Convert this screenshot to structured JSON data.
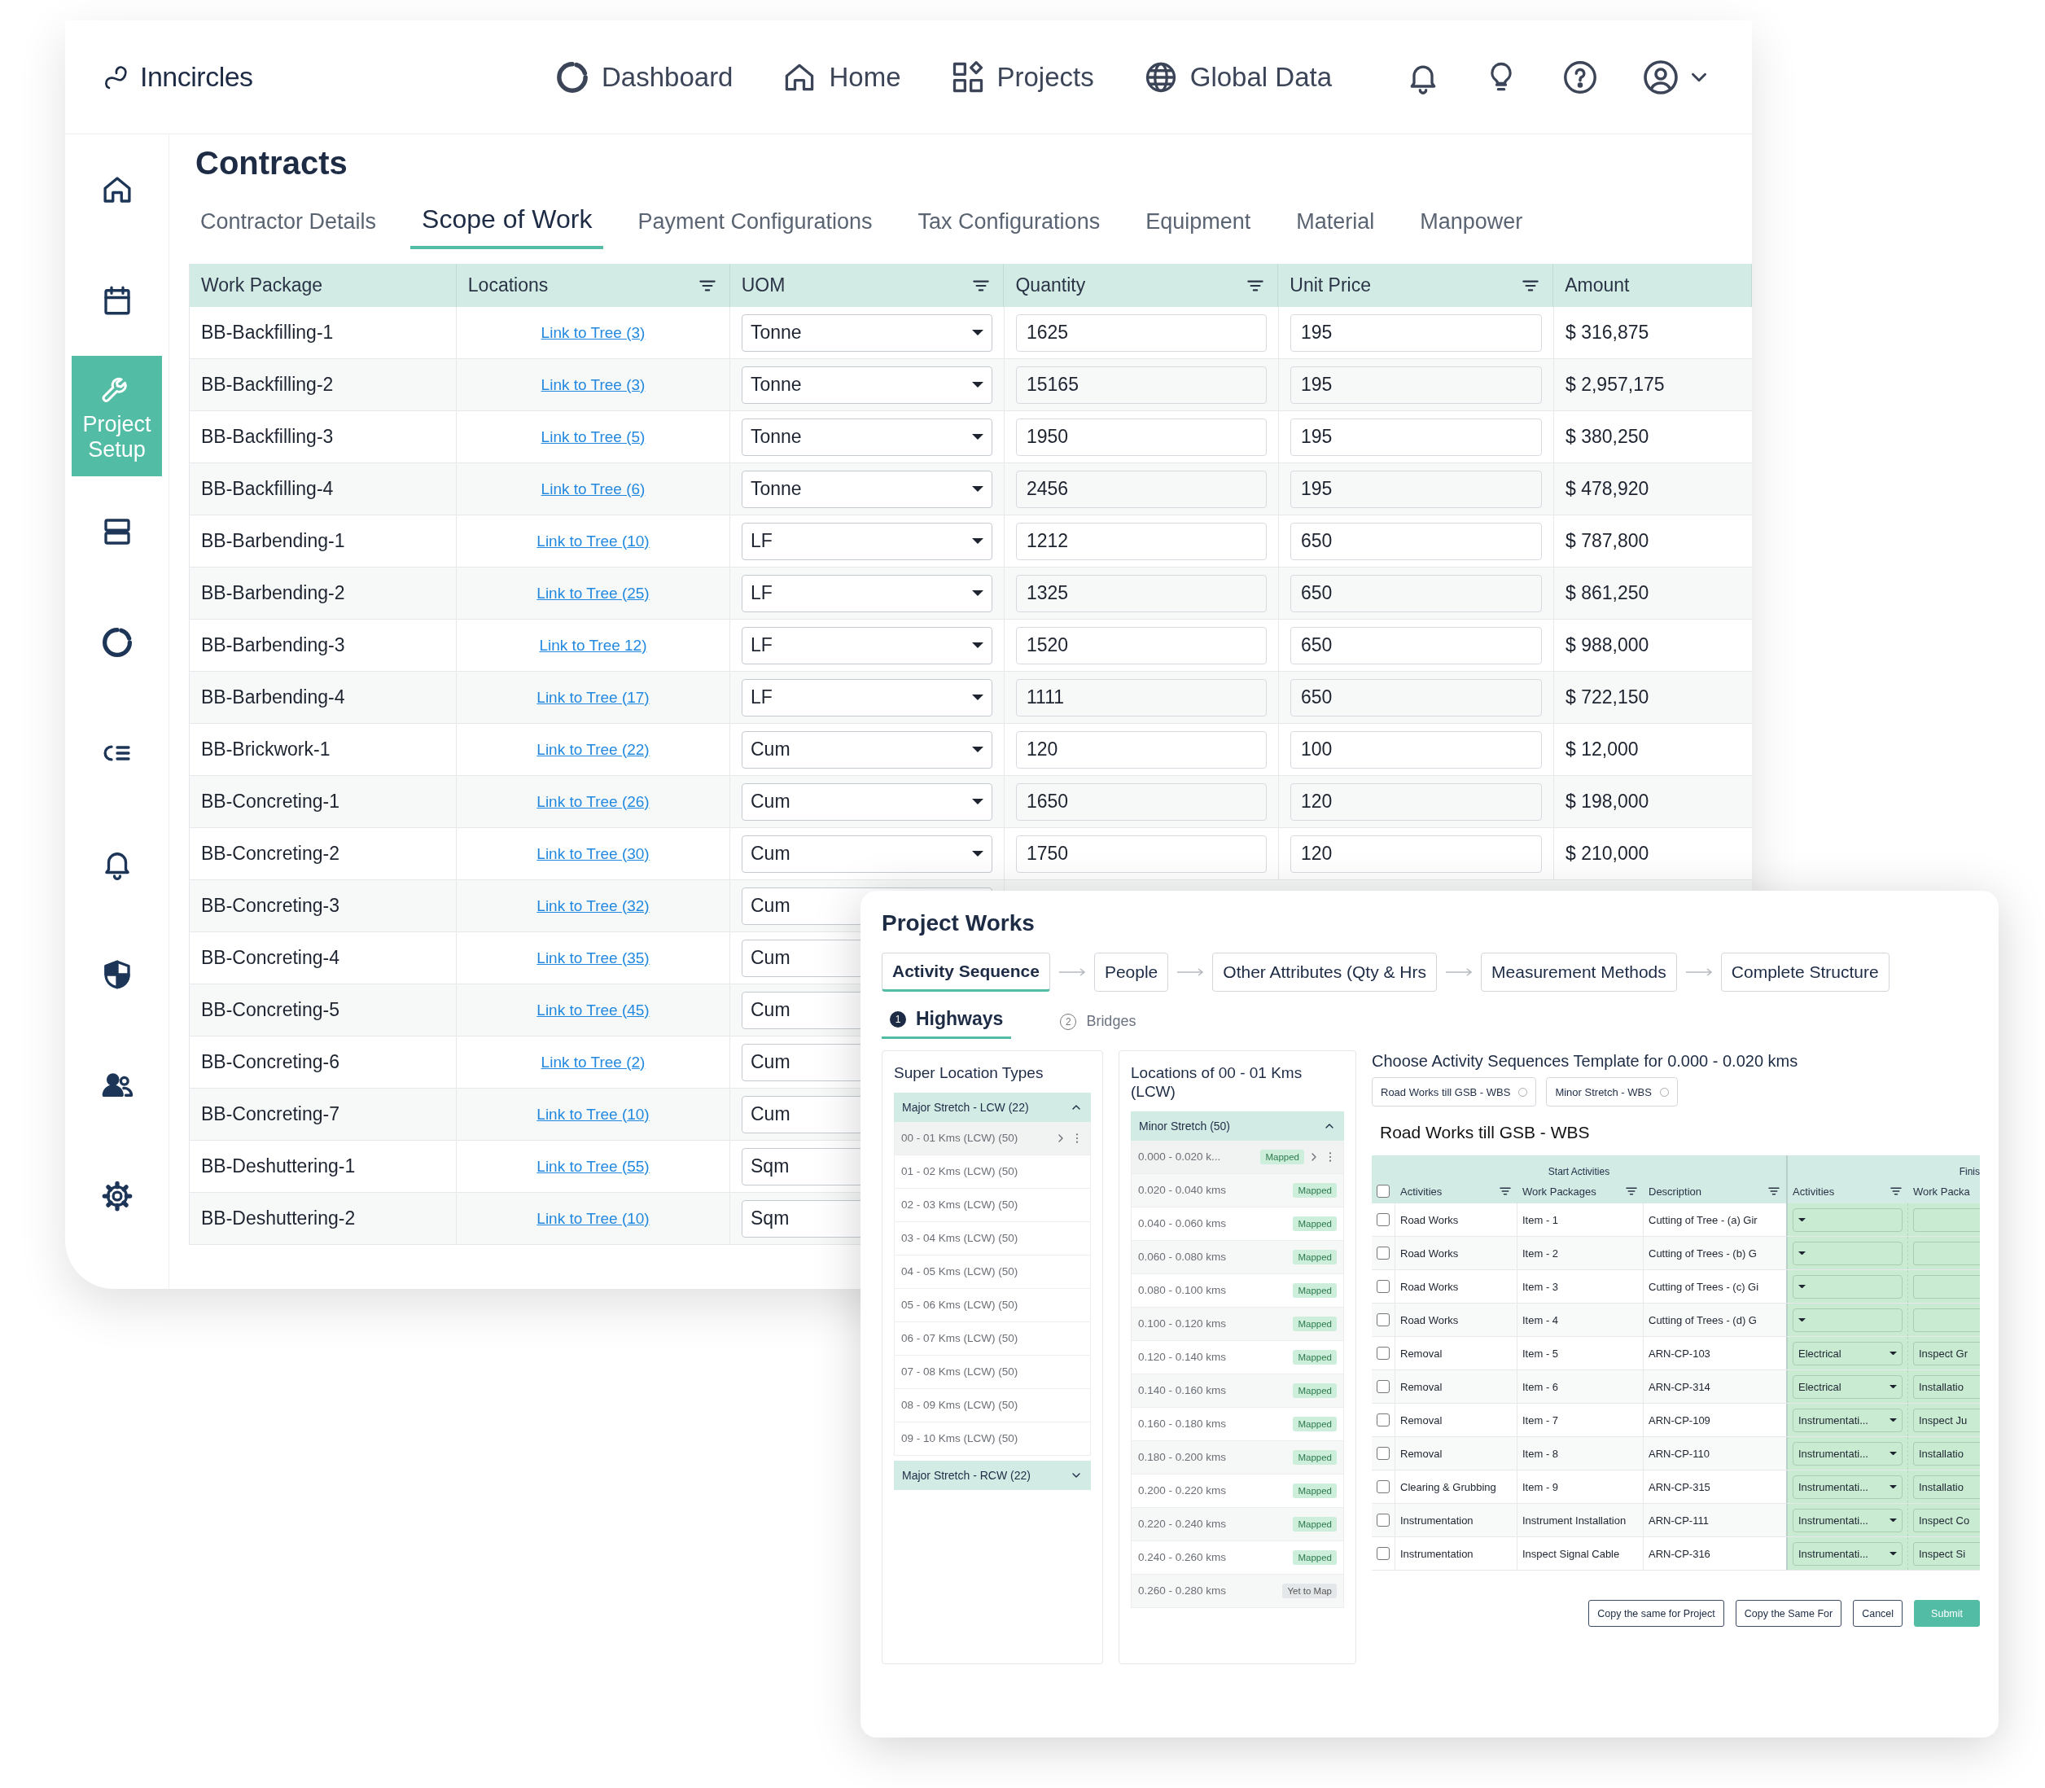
{
  "header": {
    "logo": "Inncircles",
    "nav": [
      "Dashboard",
      "Home",
      "Projects",
      "Global Data"
    ]
  },
  "sidebar": {
    "items": [
      {
        "selected": false
      },
      {
        "selected": false
      },
      {
        "selected": true,
        "label": "Project Setup"
      },
      {
        "selected": false
      },
      {
        "selected": false
      },
      {
        "selected": false
      },
      {
        "selected": false
      },
      {
        "selected": false
      },
      {
        "selected": false
      },
      {
        "selected": false
      }
    ]
  },
  "page": {
    "title": "Contracts",
    "tabs": [
      {
        "label": "Contractor Details",
        "selected": false
      },
      {
        "label": "Scope of Work",
        "selected": true
      },
      {
        "label": "Payment Configurations",
        "selected": false
      },
      {
        "label": "Tax Configurations",
        "selected": false
      },
      {
        "label": "Equipment",
        "selected": false
      },
      {
        "label": "Material",
        "selected": false
      },
      {
        "label": "Manpower",
        "selected": false
      }
    ]
  },
  "table": {
    "columns": [
      {
        "label": "Work Package",
        "filterable": false
      },
      {
        "label": "Locations",
        "filterable": true
      },
      {
        "label": "UOM",
        "filterable": true
      },
      {
        "label": "Quantity",
        "filterable": true
      },
      {
        "label": "Unit Price",
        "filterable": true
      },
      {
        "label": "Amount",
        "filterable": false
      }
    ],
    "rows": [
      {
        "work_package": "BB-Backfilling-1",
        "locations": "Link to Tree (3)",
        "uom": "Tonne",
        "quantity": "1625",
        "unit_price": "195",
        "amount": "$ 316,875"
      },
      {
        "work_package": "BB-Backfilling-2",
        "locations": "Link to Tree (3)",
        "uom": "Tonne",
        "quantity": "15165",
        "unit_price": "195",
        "amount": "$ 2,957,175"
      },
      {
        "work_package": "BB-Backfilling-3",
        "locations": "Link to Tree (5)",
        "uom": "Tonne",
        "quantity": "1950",
        "unit_price": "195",
        "amount": "$ 380,250"
      },
      {
        "work_package": "BB-Backfilling-4",
        "locations": "Link to Tree (6)",
        "uom": "Tonne",
        "quantity": "2456",
        "unit_price": "195",
        "amount": "$ 478,920"
      },
      {
        "work_package": "BB-Barbending-1",
        "locations": "Link to Tree (10)",
        "uom": "LF",
        "quantity": "1212",
        "unit_price": "650",
        "amount": "$ 787,800"
      },
      {
        "work_package": "BB-Barbending-2",
        "locations": "Link to Tree (25)",
        "uom": "LF",
        "quantity": "1325",
        "unit_price": "650",
        "amount": "$ 861,250"
      },
      {
        "work_package": "BB-Barbending-3",
        "locations": "Link to Tree 12)",
        "uom": "LF",
        "quantity": "1520",
        "unit_price": "650",
        "amount": "$ 988,000"
      },
      {
        "work_package": "BB-Barbending-4",
        "locations": "Link to Tree (17)",
        "uom": "LF",
        "quantity": "1111",
        "unit_price": "650",
        "amount": "$ 722,150"
      },
      {
        "work_package": "BB-Brickwork-1",
        "locations": "Link to Tree (22)",
        "uom": "Cum",
        "quantity": "120",
        "unit_price": "100",
        "amount": "$ 12,000"
      },
      {
        "work_package": "BB-Concreting-1",
        "locations": "Link to Tree (26)",
        "uom": "Cum",
        "quantity": "1650",
        "unit_price": "120",
        "amount": "$ 198,000"
      },
      {
        "work_package": "BB-Concreting-2",
        "locations": "Link to Tree (30)",
        "uom": "Cum",
        "quantity": "1750",
        "unit_price": "120",
        "amount": "$ 210,000"
      },
      {
        "work_package": "BB-Concreting-3",
        "locations": "Link to Tree (32)",
        "uom": "Cum"
      },
      {
        "work_package": "BB-Concreting-4",
        "locations": "Link to Tree (35)",
        "uom": "Cum"
      },
      {
        "work_package": "BB-Concreting-5",
        "locations": "Link to Tree (45)",
        "uom": "Cum"
      },
      {
        "work_package": "BB-Concreting-6",
        "locations": "Link to Tree (2)",
        "uom": "Cum"
      },
      {
        "work_package": "BB-Concreting-7",
        "locations": "Link to Tree (10)",
        "uom": "Cum"
      },
      {
        "work_package": "BB-Deshuttering-1",
        "locations": "Link to Tree (55)",
        "uom": "Sqm"
      },
      {
        "work_package": "BB-Deshuttering-2",
        "locations": "Link to Tree (10)",
        "uom": "Sqm"
      }
    ]
  },
  "project_works": {
    "title": "Project Works",
    "steps": [
      {
        "label": "Activity Sequence",
        "selected": true
      },
      {
        "label": "People",
        "selected": false
      },
      {
        "label": "Other Attributes (Qty & Hrs",
        "selected": false
      },
      {
        "label": "Measurement Methods",
        "selected": false
      },
      {
        "label": "Complete Structure",
        "selected": false
      }
    ],
    "sections": [
      {
        "number": "1",
        "label": "Highways",
        "selected": true
      },
      {
        "number": "2",
        "label": "Bridges",
        "selected": false
      }
    ],
    "super_locations": {
      "title": "Super Location Types",
      "groups": [
        {
          "label": "Major Stretch - LCW (22)",
          "expanded": true,
          "items": [
            {
              "label": "00 - 01 Kms (LCW) (50)",
              "selected": true
            },
            {
              "label": "01 - 02 Kms (LCW) (50)",
              "selected": false
            },
            {
              "label": "02 - 03 Kms (LCW) (50)",
              "selected": false
            },
            {
              "label": "03 - 04 Kms (LCW) (50)",
              "selected": false
            },
            {
              "label": "04 - 05 Kms (LCW) (50)",
              "selected": false
            },
            {
              "label": "05 - 06 Kms (LCW) (50)",
              "selected": false
            },
            {
              "label": "06 - 07 Kms (LCW) (50)",
              "selected": false
            },
            {
              "label": "07 - 08 Kms (LCW) (50)",
              "selected": false
            },
            {
              "label": "08 - 09 Kms (LCW) (50)",
              "selected": false
            },
            {
              "label": "09 - 10 Kms (LCW) (50)",
              "selected": false
            }
          ]
        },
        {
          "label": "Major Stretch - RCW (22)",
          "expanded": false
        }
      ]
    },
    "locations": {
      "title": "Locations of 00 - 01 Kms (LCW)",
      "groups": [
        {
          "label": "Minor Stretch (50)",
          "expanded": true,
          "items": [
            {
              "label": "0.000 - 0.020 k...",
              "status": "Mapped",
              "kind": "mapped",
              "selected": true
            },
            {
              "label": "0.020 - 0.040 kms",
              "status": "Mapped",
              "kind": "mapped",
              "selected": false
            },
            {
              "label": "0.040 - 0.060 kms",
              "status": "Mapped",
              "kind": "mapped",
              "selected": false
            },
            {
              "label": "0.060 - 0.080 kms",
              "status": "Mapped",
              "kind": "mapped",
              "selected": false
            },
            {
              "label": "0.080 - 0.100 kms",
              "status": "Mapped",
              "kind": "mapped",
              "selected": false
            },
            {
              "label": "0.100 - 0.120 kms",
              "status": "Mapped",
              "kind": "mapped",
              "selected": false
            },
            {
              "label": "0.120 - 0.140 kms",
              "status": "Mapped",
              "kind": "mapped",
              "selected": false
            },
            {
              "label": "0.140 - 0.160 kms",
              "status": "Mapped",
              "kind": "mapped",
              "selected": false
            },
            {
              "label": "0.160 - 0.180 kms",
              "status": "Mapped",
              "kind": "mapped",
              "selected": false
            },
            {
              "label": "0.180 - 0.200 kms",
              "status": "Mapped",
              "kind": "mapped",
              "selected": false
            },
            {
              "label": "0.200 - 0.220 kms",
              "status": "Mapped",
              "kind": "mapped",
              "selected": false
            },
            {
              "label": "0.220 - 0.240 kms",
              "status": "Mapped",
              "kind": "mapped",
              "selected": false
            },
            {
              "label": "0.240 - 0.260 kms",
              "status": "Mapped",
              "kind": "mapped",
              "selected": false
            },
            {
              "label": "0.260 - 0.280 kms",
              "status": "Yet to Map",
              "kind": "pending",
              "selected": false
            }
          ]
        }
      ]
    },
    "template": {
      "title": "Choose Activity Sequences Template for 0.000 - 0.020 kms",
      "options": [
        {
          "label": "Road Works till GSB - WBS",
          "selected": false
        },
        {
          "label": "Minor Stretch - WBS",
          "selected": false
        }
      ],
      "heading": "Road Works till GSB - WBS",
      "group_headers": [
        "Start Activities",
        "Finis"
      ],
      "all_checked": false,
      "columns": [
        {
          "label": "Activities",
          "filterable": true
        },
        {
          "label": "Work Packages",
          "filterable": true
        },
        {
          "label": "Description",
          "filterable": true
        },
        {
          "label": "Activities",
          "filterable": true
        },
        {
          "label": "Work Packa",
          "filterable": false
        }
      ],
      "rows": [
        {
          "checked": false,
          "activity": "Road Works",
          "work_package": "Item - 1",
          "description": "Cutting of Tree - (a) Gir"
        },
        {
          "checked": false,
          "activity": "Road Works",
          "work_package": "Item - 2",
          "description": "Cutting of Trees - (b) G"
        },
        {
          "checked": false,
          "activity": "Road Works",
          "work_package": "Item - 3",
          "description": "Cutting of Trees - (c) Gi"
        },
        {
          "checked": false,
          "activity": "Road Works",
          "work_package": "Item - 4",
          "description": "Cutting of Trees - (d) G"
        },
        {
          "checked": false,
          "activity": "Removal",
          "work_package": "Item - 5",
          "description": "ARN-CP-103",
          "finish_activity": "Electrical",
          "finish_work_package": "Inspect Gr"
        },
        {
          "checked": false,
          "activity": "Removal",
          "work_package": "Item - 6",
          "description": "ARN-CP-314",
          "finish_activity": "Electrical",
          "finish_work_package": "Installatio"
        },
        {
          "checked": false,
          "activity": "Removal",
          "work_package": "Item - 7",
          "description": "ARN-CP-109",
          "finish_activity": "Instrumentati...",
          "finish_work_package": "Inspect Ju"
        },
        {
          "checked": false,
          "activity": "Removal",
          "work_package": "Item - 8",
          "description": "ARN-CP-110",
          "finish_activity": "Instrumentati...",
          "finish_work_package": "Installatio"
        },
        {
          "checked": false,
          "activity": "Clearing & Grubbing",
          "work_package": "Item - 9",
          "description": "ARN-CP-315",
          "finish_activity": "Instrumentati...",
          "finish_work_package": "Installatio"
        },
        {
          "checked": false,
          "activity": "Instrumentation",
          "work_package": "Instrument Installation",
          "description": "ARN-CP-111",
          "finish_activity": "Instrumentati...",
          "finish_work_package": "Inspect Co"
        },
        {
          "checked": false,
          "activity": "Instrumentation",
          "work_package": "Inspect Signal Cable",
          "description": "ARN-CP-316",
          "finish_activity": "Instrumentati...",
          "finish_work_package": "Inspect Si"
        }
      ]
    },
    "buttons": [
      {
        "label": "Copy the same for Project",
        "kind": "outline"
      },
      {
        "label": "Copy the Same For",
        "kind": "outline"
      },
      {
        "label": "Cancel",
        "kind": "outline"
      },
      {
        "label": "Submit",
        "kind": "primary"
      }
    ]
  }
}
